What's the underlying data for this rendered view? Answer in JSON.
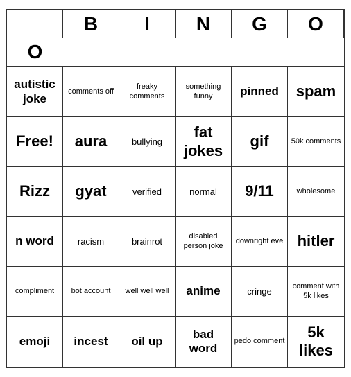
{
  "header": {
    "letters": [
      "",
      "B",
      "I",
      "N",
      "G",
      "O",
      "O"
    ]
  },
  "grid": {
    "cells": [
      {
        "text": "autistic joke",
        "size": "medium"
      },
      {
        "text": "comments off",
        "size": "small"
      },
      {
        "text": "freaky comments",
        "size": "small"
      },
      {
        "text": "something funny",
        "size": "small"
      },
      {
        "text": "pinned",
        "size": "medium"
      },
      {
        "text": "spam",
        "size": "large"
      },
      {
        "text": "Free!",
        "size": "large"
      },
      {
        "text": "aura",
        "size": "large"
      },
      {
        "text": "bullying",
        "size": "normal"
      },
      {
        "text": "fat jokes",
        "size": "large"
      },
      {
        "text": "gif",
        "size": "large"
      },
      {
        "text": "50k comments",
        "size": "small"
      },
      {
        "text": "Rizz",
        "size": "large"
      },
      {
        "text": "gyat",
        "size": "large"
      },
      {
        "text": "verified",
        "size": "normal"
      },
      {
        "text": "normal",
        "size": "normal"
      },
      {
        "text": "9/11",
        "size": "large"
      },
      {
        "text": "wholesome",
        "size": "small"
      },
      {
        "text": "n word",
        "size": "medium"
      },
      {
        "text": "racism",
        "size": "normal"
      },
      {
        "text": "brainrot",
        "size": "normal"
      },
      {
        "text": "disabled person joke",
        "size": "small"
      },
      {
        "text": "downright eve",
        "size": "small"
      },
      {
        "text": "hitler",
        "size": "large"
      },
      {
        "text": "compliment",
        "size": "small"
      },
      {
        "text": "bot account",
        "size": "small"
      },
      {
        "text": "well well well",
        "size": "small"
      },
      {
        "text": "anime",
        "size": "medium"
      },
      {
        "text": "cringe",
        "size": "normal"
      },
      {
        "text": "comment with 5k likes",
        "size": "small"
      },
      {
        "text": "emoji",
        "size": "medium"
      },
      {
        "text": "incest",
        "size": "medium"
      },
      {
        "text": "oil up",
        "size": "medium"
      },
      {
        "text": "bad word",
        "size": "medium"
      },
      {
        "text": "pedo comment",
        "size": "small"
      },
      {
        "text": "5k likes",
        "size": "large"
      }
    ]
  }
}
